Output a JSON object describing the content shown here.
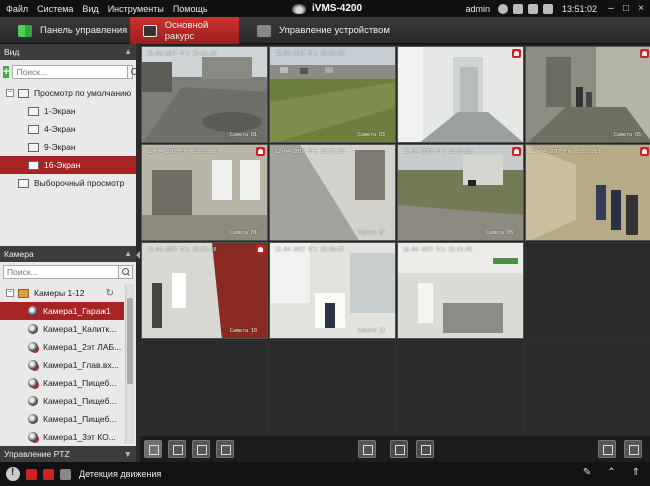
{
  "menu": [
    "Файл",
    "Система",
    "Вид",
    "Инструменты",
    "Помощь"
  ],
  "app_title": "iVMS-4200",
  "user": "admin",
  "clock": "13:51:02",
  "window_controls": {
    "minimize": "–",
    "maximize": "□",
    "close": "×"
  },
  "tabs": [
    {
      "label": "Панель управления",
      "active": false
    },
    {
      "label": "Основной ракурс",
      "active": true
    },
    {
      "label": "Управление устройством",
      "active": false
    }
  ],
  "view_panel": {
    "title": "Вид",
    "search_placeholder": "Поиск...",
    "default_group": "Просмотр по умолчанию",
    "layouts": [
      {
        "label": "1-Экран",
        "selected": false
      },
      {
        "label": "4-Экран",
        "selected": false
      },
      {
        "label": "9-Экран",
        "selected": false
      },
      {
        "label": "16-Экран",
        "selected": true
      }
    ],
    "custom": "Выборочный просмотр"
  },
  "camera_panel": {
    "title": "Камера",
    "search_placeholder": "Поиск...",
    "group": "Камеры 1-12",
    "cameras": [
      {
        "label": "Камера1_Гараж1",
        "selected": true
      },
      {
        "label": "Камера1_Калитк...",
        "selected": false
      },
      {
        "label": "Камера1_2эт ЛАБ...",
        "selected": false
      },
      {
        "label": "Камера1_Глав.вх...",
        "selected": false
      },
      {
        "label": "Камера1_Пищеб...",
        "selected": false
      },
      {
        "label": "Камера1_Пищеб...",
        "selected": false
      },
      {
        "label": "Камера1_Пищеб...",
        "selected": false
      },
      {
        "label": "Камера1_3эт КО...",
        "selected": false
      }
    ]
  },
  "ptz_panel": {
    "title": "Управление PTZ"
  },
  "feeds": [
    {
      "osd": "12-04-2017 Fri 13:51:10",
      "name": "Camera 01",
      "alarm": false
    },
    {
      "osd": "12-04-2017 Fri 13:51:10",
      "name": "Camera 03",
      "alarm": false
    },
    {
      "osd": "",
      "name": "",
      "alarm": true
    },
    {
      "osd": "",
      "name": "Camera 05",
      "alarm": true
    },
    {
      "osd": "12-04-2017 Fri 13:51:10",
      "name": "Camera 01",
      "alarm": true
    },
    {
      "osd": "12-04-2017 Fri 13:51:13",
      "name": "Camera 07",
      "alarm": false
    },
    {
      "osd": "12-04-2017 Fri 13:51:53",
      "name": "Camera 08",
      "alarm": true
    },
    {
      "osd": "12-04-2017 Fri 13:51:13",
      "name": "",
      "alarm": true
    },
    {
      "osd": "12-04-2017 Fri 13:51:10",
      "name": "Camera 10",
      "alarm": true
    },
    {
      "osd": "12-04-2017 Fri 13:50:57",
      "name": "Camera 11",
      "alarm": false
    },
    {
      "osd": "12-04-2017 Fri 13:51:02",
      "name": "",
      "alarm": false
    }
  ],
  "status": {
    "text": "Детекция движения"
  },
  "colors": {
    "accent": "#a82424",
    "dark": "#1e1e1e"
  }
}
